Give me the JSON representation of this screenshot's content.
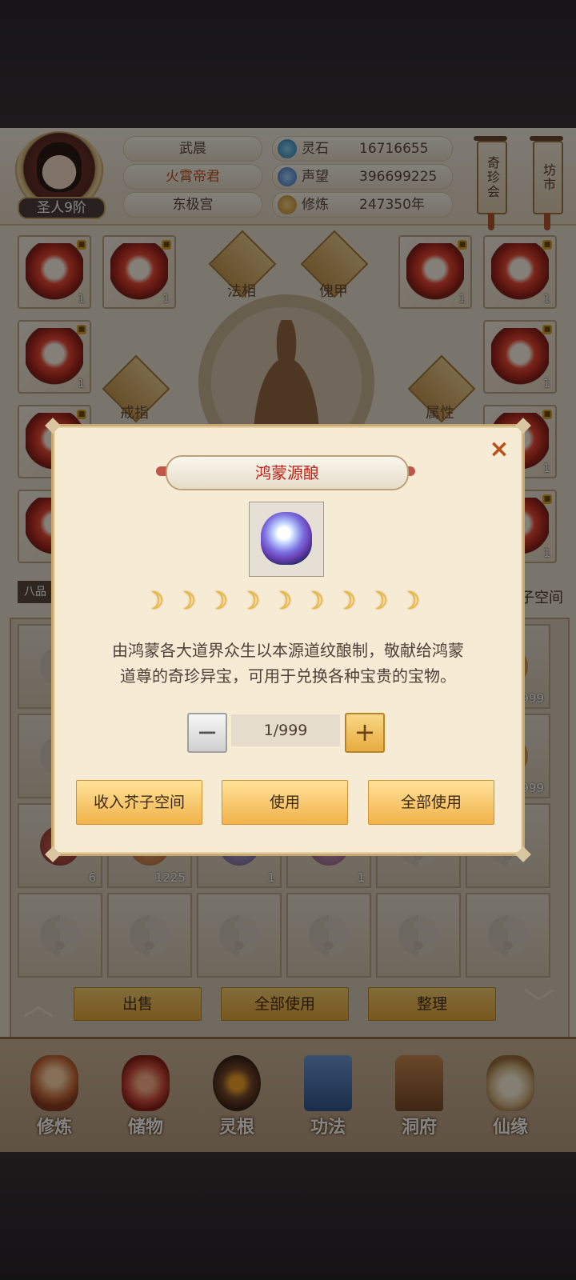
{
  "player": {
    "name": "武晨",
    "title": "火霄帝君",
    "sect": "东极宫",
    "rank": "圣人9阶"
  },
  "stats": [
    {
      "icon": "spirit-stone-icon",
      "label": "灵石",
      "value": "16716655"
    },
    {
      "icon": "reputation-icon",
      "label": "声望",
      "value": "396699225"
    },
    {
      "icon": "cultivation-icon",
      "label": "修炼",
      "value": "247350年"
    }
  ],
  "side_buttons": {
    "treasure_market": "奇珍会",
    "shop": "坊市"
  },
  "equip_labels": {
    "dharma": "法相",
    "puppet": "傀甲",
    "ring": "戒指",
    "attribute": "属性"
  },
  "equip_count": "1",
  "inventory": {
    "grade_tab": "八品",
    "space_label": "子空间",
    "counts": [
      "9999",
      "9999",
      "6",
      "1225",
      "1",
      "1"
    ]
  },
  "inventory_actions": {
    "sell": "出售",
    "use_all": "全部使用",
    "sort": "整理"
  },
  "nav": [
    {
      "label": "修炼",
      "color": "#c96a3b"
    },
    {
      "label": "储物",
      "color": "#d04a3a"
    },
    {
      "label": "灵根",
      "color": "#7a4a2c"
    },
    {
      "label": "功法",
      "color": "#4a78b8"
    },
    {
      "label": "洞府",
      "color": "#a06a40"
    },
    {
      "label": "仙缘",
      "color": "#d8b98a"
    }
  ],
  "modal": {
    "title": "鸿蒙源酿",
    "close": "×",
    "stars": "☽",
    "description_line1": "由鸿蒙各大道界众生以本源道纹酿制，敬献给鸿蒙",
    "description_line2": "道尊的奇珍异宝，可用于兑换各种宝贵的宝物。",
    "minus": "−",
    "quantity": "1/999",
    "plus": "+",
    "btn_store": "收入芥子空间",
    "btn_use": "使用",
    "btn_use_all": "全部使用"
  }
}
